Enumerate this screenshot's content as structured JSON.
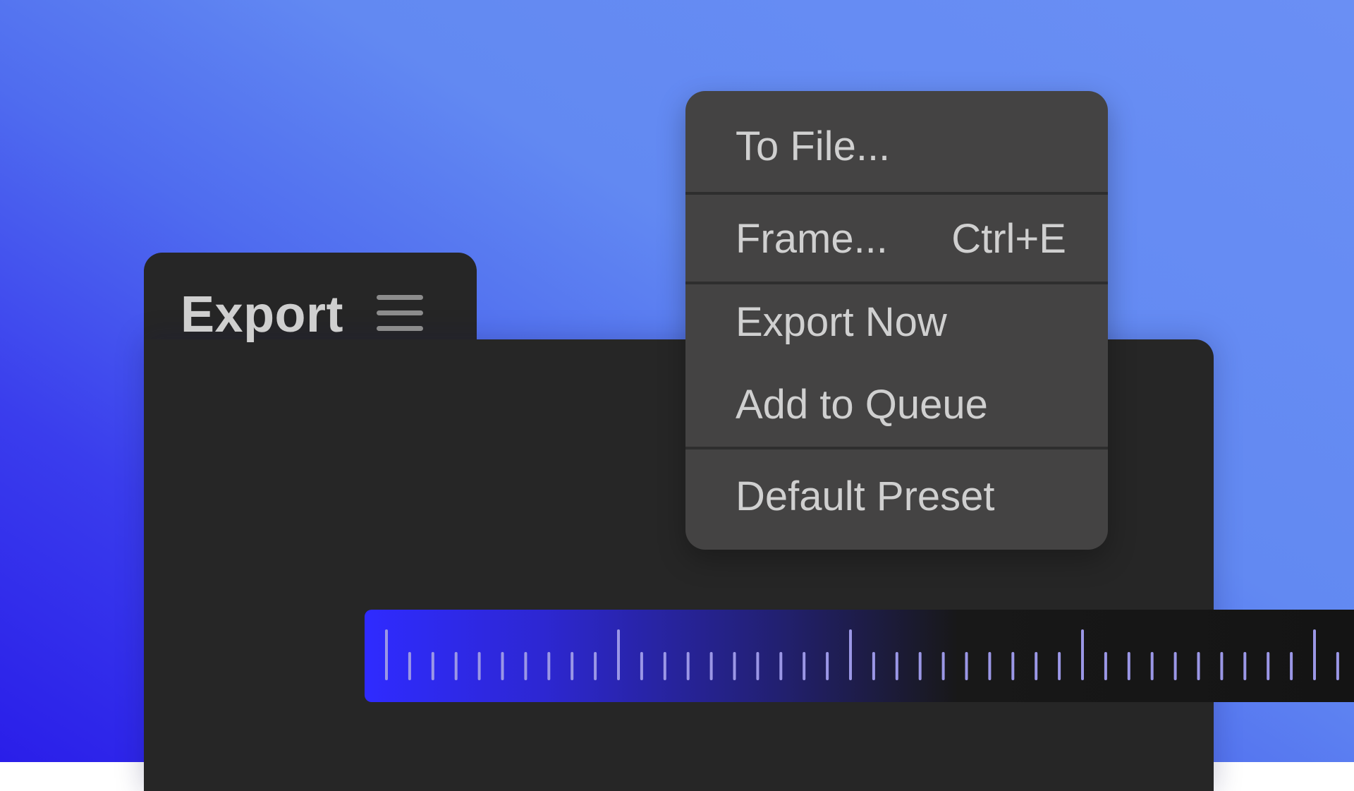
{
  "panel": {
    "title": "Export",
    "menu_icon": "hamburger-menu-icon"
  },
  "menu": {
    "items": [
      {
        "label": "To File...",
        "shortcut": ""
      },
      {
        "label": "Frame...",
        "shortcut": "Ctrl+E"
      },
      {
        "label": "Export Now",
        "shortcut": ""
      },
      {
        "label": "Add to Queue",
        "shortcut": ""
      },
      {
        "label": "Default Preset",
        "shortcut": ""
      }
    ]
  },
  "colors": {
    "background_light": "#6a8ff4",
    "background_deep": "#2a1ee9",
    "panel": "#262626",
    "menu": "#444343",
    "menu_text": "#d0d0d0",
    "ruler_accent": "#2f2bff",
    "tick": "#9b97e6"
  }
}
